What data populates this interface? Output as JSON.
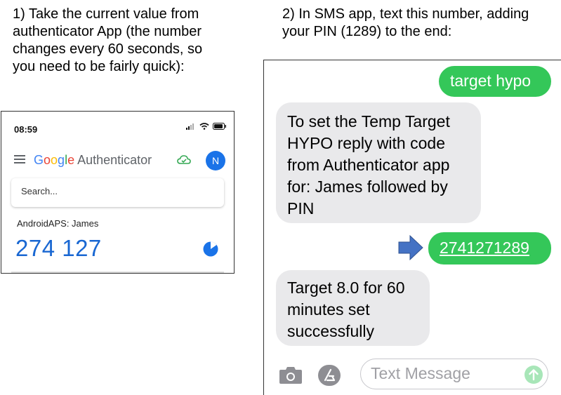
{
  "instructions": {
    "step1": "1) Take the current value from\nauthenticator App (the number\nchanges every 60 seconds, so\nyou need to be fairly quick):",
    "step2": "2) In SMS app, text this number, adding\nyour PIN (1289) to the end:"
  },
  "authenticator": {
    "status_time": "08:59",
    "logo_letters": [
      "G",
      "o",
      "o",
      "g",
      "l",
      "e"
    ],
    "app_name": "Authenticator",
    "avatar_initial": "N",
    "search_placeholder": "Search...",
    "account_label": "AndroidAPS: James",
    "code": "274 127",
    "colors": {
      "code": "#1967d2",
      "avatar": "#1a73e8",
      "cloud": "#34A853"
    },
    "icons": [
      "hamburger-menu-icon",
      "cloud-sync-icon",
      "signal-icon",
      "wifi-icon",
      "battery-icon",
      "timer-icon"
    ]
  },
  "messages": {
    "sent1": "target hypo",
    "received1": "To set the Temp Target\nHYPO reply with code\nfrom Authenticator app\nfor: James followed by\nPIN",
    "sent2": "2741271289",
    "received2": "Target 8.0 for 60\nminutes set\nsuccessfully",
    "input_placeholder": "Text Message",
    "colors": {
      "sent": "#34c759",
      "received": "#e9e9eb",
      "arrow": "#4472c4"
    },
    "icons": [
      "camera-icon",
      "app-store-icon",
      "send-arrow-icon",
      "right-arrow-icon"
    ]
  }
}
